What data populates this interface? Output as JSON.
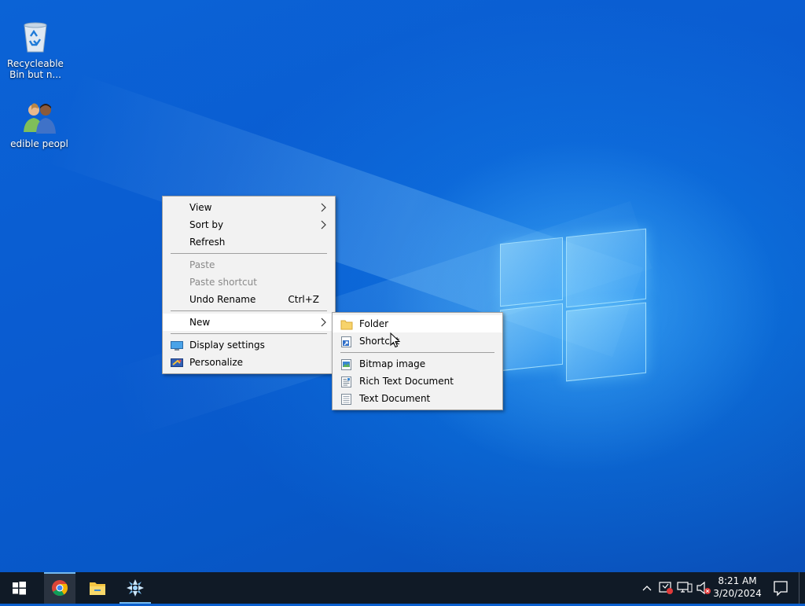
{
  "desktop": {
    "icons": [
      {
        "label": "Recycleable Bin but n...",
        "icon": "recycle-bin-icon"
      },
      {
        "label": "edible peopl",
        "icon": "users-icon"
      }
    ]
  },
  "context_menu": {
    "items": [
      {
        "label": "View",
        "submenu": true
      },
      {
        "label": "Sort by",
        "submenu": true
      },
      {
        "label": "Refresh"
      },
      {
        "label": "Paste",
        "disabled": true
      },
      {
        "label": "Paste shortcut",
        "disabled": true
      },
      {
        "label": "Undo Rename",
        "shortcut": "Ctrl+Z"
      },
      {
        "label": "New",
        "submenu": true,
        "active": true
      },
      {
        "label": "Display settings",
        "icon": "display-settings-icon"
      },
      {
        "label": "Personalize",
        "icon": "personalize-icon"
      }
    ]
  },
  "new_submenu": {
    "items": [
      {
        "label": "Folder",
        "icon": "folder-icon"
      },
      {
        "label": "Shortcut",
        "icon": "shortcut-icon"
      },
      {
        "label": "Bitmap image",
        "icon": "bitmap-icon"
      },
      {
        "label": "Rich Text Document",
        "icon": "rich-text-icon"
      },
      {
        "label": "Text Document",
        "icon": "text-document-icon"
      }
    ]
  },
  "taskbar": {
    "apps": [
      "start-icon",
      "chrome-icon",
      "file-explorer-icon",
      "app-icon"
    ],
    "tray_icons": [
      "chevron-up-icon",
      "security-icon",
      "network-icon",
      "volume-muted-icon",
      "notifications-icon"
    ],
    "clock": {
      "time": "8:21 AM",
      "date": "3/20/2024"
    }
  },
  "colors": {
    "desktop_blue": "#0a5fcf",
    "taskbar": "#101a26",
    "menu_bg": "#f2f2f2",
    "menu_highlight": "#ffffff",
    "active_app_indicator": "#76b9ed"
  }
}
